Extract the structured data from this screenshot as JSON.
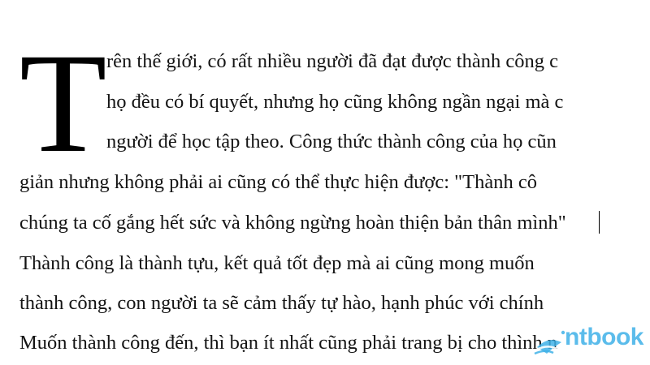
{
  "document": {
    "drop_cap": "T",
    "lines": [
      "rên thế giới, có rất nhiều người đã đạt được thành công c",
      "họ đều có bí quyết, nhưng họ cũng không ngần ngại mà c",
      "người để học tập theo. Công thức thành công của họ cũn",
      "giản nhưng không phải ai cũng có thể thực hiện được: \"Thành cô",
      "chúng ta cố gắng hết sức và không ngừng hoàn thiện bản thân mình\"",
      "Thành công là thành tựu, kết quả tốt đẹp mà ai cũng mong muốn",
      "thành công, con người ta sẽ cảm thấy tự hào, hạnh phúc với chính",
      "Muốn thành công đến, thì bạn ít nhất cũng phải trang bị cho thình n"
    ]
  },
  "watermark": {
    "text": "ntbook",
    "color": "#3fb1e8"
  }
}
